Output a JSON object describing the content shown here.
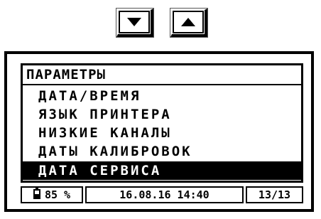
{
  "nav_buttons": {
    "down_icon": "triangle-down-icon",
    "up_icon": "triangle-up-icon"
  },
  "menu": {
    "title": "ПАРАМЕТРЫ",
    "items": [
      {
        "label": "ДАТА/ВРЕМЯ",
        "selected": false
      },
      {
        "label": "ЯЗЫК ПРИНТЕРА",
        "selected": false
      },
      {
        "label": "НИЗКИЕ КАНАЛЫ",
        "selected": false
      },
      {
        "label": "ДАТЫ КАЛИБРОВОК",
        "selected": false
      },
      {
        "label": "ДАТА СЕРВИСА",
        "selected": true
      }
    ]
  },
  "status_bar": {
    "battery_icon": "battery-icon",
    "battery_level": "85 %",
    "datetime": "16.08.16 14:40",
    "page": "13/13"
  },
  "colors": {
    "foreground": "#000000",
    "background": "#ffffff"
  }
}
